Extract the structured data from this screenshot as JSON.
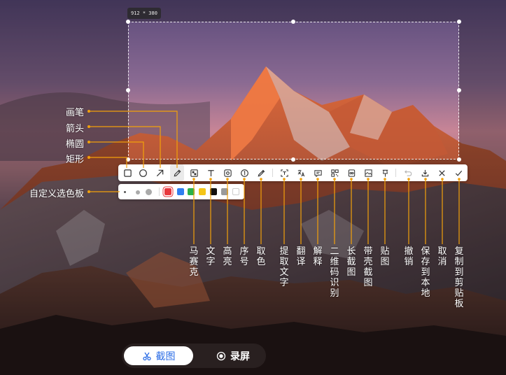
{
  "selection": {
    "size_label": "912 * 380"
  },
  "toolbar": {
    "tools": [
      {
        "name": "rectangle-tool",
        "icon": "square-icon"
      },
      {
        "name": "ellipse-tool",
        "icon": "circle-icon"
      },
      {
        "name": "arrow-tool",
        "icon": "arrow-icon"
      },
      {
        "name": "pen-tool",
        "icon": "pen-icon"
      },
      {
        "name": "mosaic-tool",
        "icon": "mosaic-icon"
      },
      {
        "name": "text-tool",
        "icon": "text-icon"
      },
      {
        "name": "highlight-tool",
        "icon": "highlight-icon"
      },
      {
        "name": "number-tool",
        "icon": "numbered-circle-icon"
      },
      {
        "name": "color-picker-tool",
        "icon": "eyedropper-icon"
      },
      {
        "name": "ocr-tool",
        "icon": "scan-text-icon"
      },
      {
        "name": "translate-tool",
        "icon": "translate-icon"
      },
      {
        "name": "explain-tool",
        "icon": "chat-icon"
      },
      {
        "name": "qrcode-tool",
        "icon": "qrcode-icon"
      },
      {
        "name": "long-screenshot-tool",
        "icon": "long-screenshot-icon"
      },
      {
        "name": "frame-screenshot-tool",
        "icon": "frame-icon"
      },
      {
        "name": "pin-tool",
        "icon": "pin-icon"
      },
      {
        "name": "undo-tool",
        "icon": "undo-icon"
      },
      {
        "name": "save-tool",
        "icon": "download-icon"
      },
      {
        "name": "cancel-tool",
        "icon": "close-icon"
      },
      {
        "name": "copy-tool",
        "icon": "check-icon"
      }
    ]
  },
  "palette": {
    "colors": [
      "#e8383d",
      "#2f7ff0",
      "#2ab14a",
      "#f5c518",
      "#111111",
      "#9a9a9a",
      "#ffffff"
    ]
  },
  "callouts": {
    "pen": "画笔",
    "arrow": "箭头",
    "ellipse": "椭圆",
    "rectangle": "矩形",
    "custom_palette": "自定义选色板"
  },
  "vertical_labels": [
    [
      "马",
      "赛",
      "克"
    ],
    [
      "文",
      "字"
    ],
    [
      "高",
      "亮"
    ],
    [
      "序",
      "号"
    ],
    [
      "取",
      "色"
    ],
    [
      "提",
      "取",
      "文",
      "字"
    ],
    [
      "翻",
      "译"
    ],
    [
      "解",
      "释"
    ],
    [
      "二",
      "维",
      "码",
      "识",
      "别"
    ],
    [
      "长",
      "截",
      "图"
    ],
    [
      "带",
      "壳",
      "截",
      "图"
    ],
    [
      "贴",
      "图"
    ],
    [
      "撤",
      "销"
    ],
    [
      "保",
      "存",
      "到",
      "本",
      "地"
    ],
    [
      "取",
      "消"
    ],
    [
      "复",
      "制",
      "到",
      "剪",
      "贴",
      "板"
    ]
  ],
  "modes": {
    "screenshot": "截图",
    "record": "录屏"
  },
  "colors": {
    "accent": "#2b6de6",
    "callout_line": "#f2a10b"
  }
}
